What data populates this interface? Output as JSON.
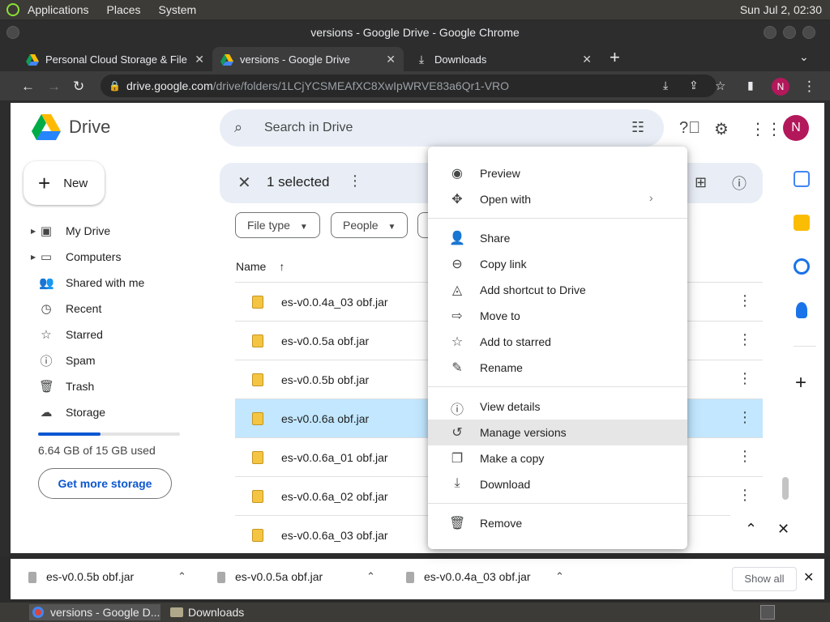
{
  "os_top": {
    "menus": [
      "Applications",
      "Places",
      "System"
    ],
    "clock": "Sun Jul 2, 02:30"
  },
  "window": {
    "title": "versions - Google Drive - Google Chrome"
  },
  "tabs": [
    {
      "label": "Personal Cloud Storage & File",
      "active": false
    },
    {
      "label": "versions - Google Drive",
      "active": true
    },
    {
      "label": "Downloads",
      "active": false
    }
  ],
  "address": {
    "host": "drive.google.com",
    "path": "/drive/folders/1LCjYCSMEAfXC8XwIpWRVE83a6Qr1-VRO"
  },
  "profile_initial": "N",
  "drive": {
    "logo_text": "Drive",
    "search_placeholder": "Search in Drive",
    "new_label": "New",
    "nav": [
      {
        "label": "My Drive",
        "icon": "my-drive-icon"
      },
      {
        "label": "Computers",
        "icon": "computers-icon"
      },
      {
        "label": "Shared with me",
        "icon": "shared-icon"
      },
      {
        "label": "Recent",
        "icon": "clock-icon"
      },
      {
        "label": "Starred",
        "icon": "star-icon"
      },
      {
        "label": "Spam",
        "icon": "spam-icon"
      },
      {
        "label": "Trash",
        "icon": "trash-icon"
      },
      {
        "label": "Storage",
        "icon": "cloud-icon"
      }
    ],
    "storage_text": "6.64 GB of 15 GB used",
    "storage_fraction": 0.44,
    "get_more": "Get more storage",
    "selection": "1 selected",
    "filters": [
      "File type",
      "People"
    ],
    "column_name": "Name",
    "files": [
      {
        "name": "es-v0.0.4a_03 obf.jar",
        "selected": false
      },
      {
        "name": "es-v0.0.5a obf.jar",
        "selected": false
      },
      {
        "name": "es-v0.0.5b obf.jar",
        "selected": false
      },
      {
        "name": "es-v0.0.6a obf.jar",
        "selected": true
      },
      {
        "name": "es-v0.0.6a_01 obf.jar",
        "selected": false
      },
      {
        "name": "es-v0.0.6a_02 obf.jar",
        "selected": false
      },
      {
        "name": "es-v0.0.6a_03 obf.jar",
        "selected": false
      }
    ]
  },
  "context_menu": {
    "items": [
      {
        "label": "Preview",
        "icon": "eye-icon"
      },
      {
        "label": "Open with",
        "icon": "move-arrows-icon",
        "submenu": true
      },
      {
        "label": "Share",
        "icon": "add-person-icon"
      },
      {
        "label": "Copy link",
        "icon": "link-icon"
      },
      {
        "label": "Add shortcut to Drive",
        "icon": "shortcut-icon"
      },
      {
        "label": "Move to",
        "icon": "move-to-icon"
      },
      {
        "label": "Add to starred",
        "icon": "star-icon"
      },
      {
        "label": "Rename",
        "icon": "pencil-icon"
      },
      {
        "label": "View details",
        "icon": "info-icon"
      },
      {
        "label": "Manage versions",
        "icon": "history-icon",
        "hover": true
      },
      {
        "label": "Make a copy",
        "icon": "copy-icon"
      },
      {
        "label": "Download",
        "icon": "download-icon"
      },
      {
        "label": "Remove",
        "icon": "trash-icon"
      }
    ]
  },
  "downloads": [
    {
      "name": "es-v0.0.5b obf.jar"
    },
    {
      "name": "es-v0.0.5a obf.jar"
    },
    {
      "name": "es-v0.0.4a_03 obf.jar"
    }
  ],
  "show_all": "Show all",
  "taskbar": [
    {
      "label": "versions - Google D...",
      "active": true
    },
    {
      "label": "Downloads",
      "active": false
    }
  ],
  "colors": {
    "accent": "#0b57d0",
    "selected_row": "#c2e7ff",
    "avatar": "#b3185b"
  }
}
